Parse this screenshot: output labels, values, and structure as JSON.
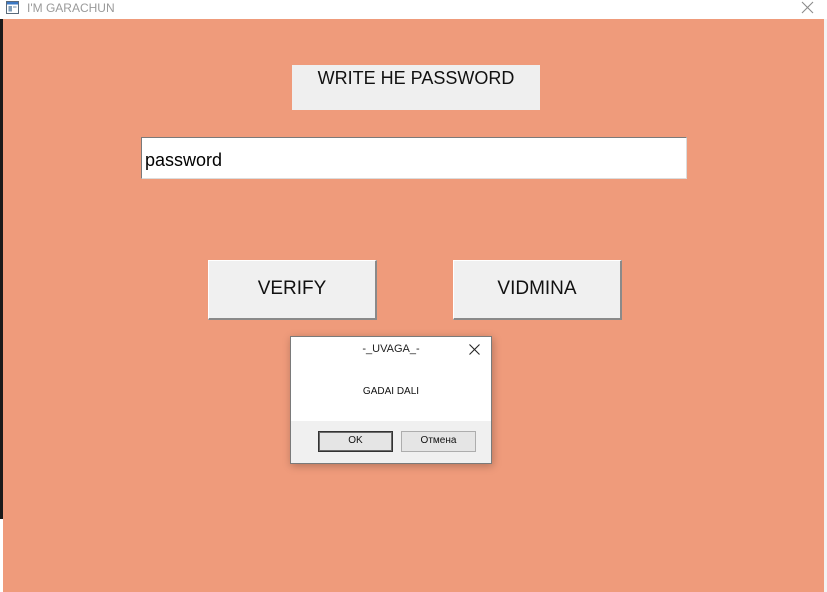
{
  "window": {
    "title": "I'M GARACHUN"
  },
  "form": {
    "prompt_label": "WRITE HE PASSWORD",
    "password_value": "password",
    "verify_label": "VERIFY",
    "vidmina_label": "VIDMINA"
  },
  "dialog": {
    "title": "-_UVAGA_-",
    "message": "GADAI DALI",
    "ok_label": "OK",
    "cancel_label": "Отмена"
  },
  "colors": {
    "client_background": "#ef9b7b",
    "button_face": "#f0f0f0"
  }
}
